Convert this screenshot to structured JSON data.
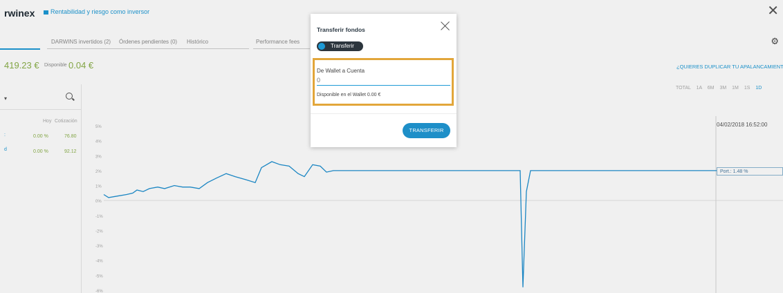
{
  "header": {
    "brand": "rwinex",
    "link": "Rentabilidad y riesgo como inversor",
    "close_glyph": "✕"
  },
  "tabs": [
    "DARWINS invertidos (2)",
    "Órdenes pendientes (0)",
    "Histórico",
    "Performance fees"
  ],
  "account": {
    "balance": "419.23 €",
    "available_label": "Disponible",
    "available_value": "0.04 €",
    "duplicate_link": "¿QUIERES DUPLICAR TU APALANCAMIENTO?"
  },
  "list": {
    "columns": [
      "Hoy",
      "Cotización"
    ],
    "rows": [
      {
        "today": "0.00 %",
        "quote": "76.80"
      },
      {
        "today": "0.00 %",
        "quote": "92.12"
      }
    ]
  },
  "periods": [
    "TOTAL",
    "1A",
    "6M",
    "3M",
    "1M",
    "1S",
    "1D"
  ],
  "chart_data": {
    "type": "line",
    "y_ticks": [
      "5%",
      "4%",
      "3%",
      "2%",
      "1%",
      "0%",
      "-1%",
      "-2%",
      "-3%",
      "-4%",
      "-5%",
      "-6%"
    ],
    "ylim": [
      -6,
      5
    ],
    "series": [
      {
        "values": [
          0.4,
          0.2,
          0.3,
          0.4,
          0.5,
          0.7,
          0.6,
          0.8,
          0.9,
          0.8,
          1.0,
          0.9,
          0.9,
          0.8,
          1.2,
          1.5,
          1.8,
          1.6,
          1.4,
          1.2,
          2.2,
          2.6,
          2.4,
          2.3,
          1.8,
          1.6,
          2.4,
          2.3,
          1.9,
          2.0,
          2.0,
          2.0,
          2.0,
          2.0,
          2.0,
          2.0,
          2.0,
          -5.8,
          0.6,
          2.0,
          2.0,
          2.0,
          2.0
        ]
      }
    ],
    "hover_date": "04/02/2018 16:52:00",
    "hover_value": "Port.: 1.48 %"
  },
  "modal": {
    "title": "Transferir fondos",
    "toggle_label": "Transferir",
    "from_label": "De Wallet a Cuenta",
    "amount_placeholder": "0",
    "available_text": "Disponible en el Wallet 0.00 €",
    "submit_label": "TRANSFERIR"
  },
  "colors": {
    "accent": "#1d9ad6",
    "positive": "#8bb04a",
    "highlight": "#e2a63a"
  }
}
